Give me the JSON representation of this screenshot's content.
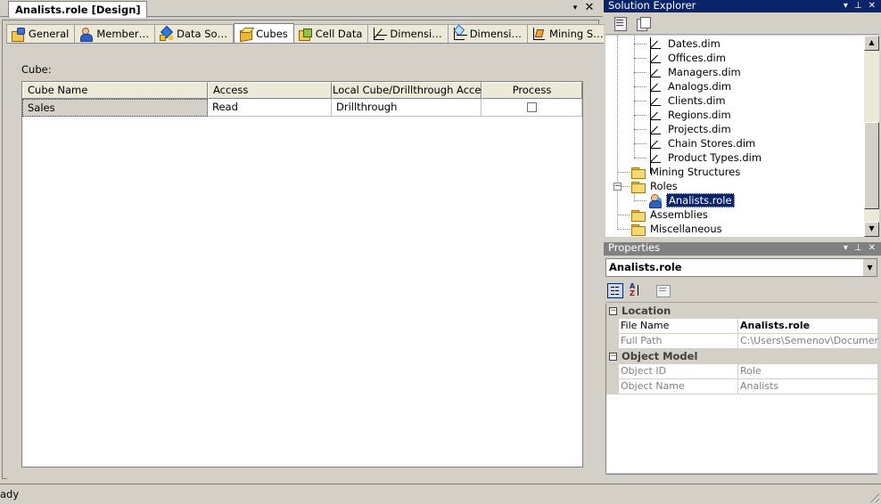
{
  "document": {
    "tab_title": "Analists.role [Design]",
    "dropdown_glyph": "▾",
    "close_glyph": "✕"
  },
  "designer_tabs": [
    {
      "label": "General",
      "icon": "general-icon"
    },
    {
      "label": "Member…",
      "icon": "membership-icon"
    },
    {
      "label": "Data So…",
      "icon": "data-sources-icon"
    },
    {
      "label": "Cubes",
      "icon": "cube-icon",
      "active": true
    },
    {
      "label": "Cell Data",
      "icon": "cell-data-icon"
    },
    {
      "label": "Dimensi…",
      "icon": "dimensions-icon"
    },
    {
      "label": "Dimensi…",
      "icon": "dimension-data-icon"
    },
    {
      "label": "Mining S…",
      "icon": "mining-structures-icon"
    }
  ],
  "cubes": {
    "label": "Cube:",
    "columns": [
      "Cube Name",
      "Access",
      "Local Cube/Drillthrough Access",
      "Process"
    ],
    "rows": [
      {
        "name": "Sales",
        "access": "Read",
        "local": "Drillthrough",
        "process": false
      }
    ]
  },
  "status": {
    "text": "ady"
  },
  "solution_explorer": {
    "title": "Solution Explorer",
    "dims": [
      "Dates.dim",
      "Offices.dim",
      "Managers.dim",
      "Analogs.dim",
      "Clients.dim",
      "Regions.dim",
      "Projects.dim",
      "Chain Stores.dim",
      "Product Types.dim"
    ],
    "folders": {
      "mining": "Mining Structures",
      "roles": "Roles",
      "assemblies": "Assemblies",
      "misc": "Miscellaneous"
    },
    "selected_role": "Analists.role"
  },
  "properties": {
    "title": "Properties",
    "object": "Analists.role",
    "categories": [
      {
        "name": "Location",
        "rows": [
          {
            "name": "File Name",
            "value": "Analists.role",
            "bold": true
          },
          {
            "name": "Full Path",
            "value": "C:\\Users\\Semenov\\Documents\\V",
            "readonly": true
          }
        ]
      },
      {
        "name": "Object Model",
        "rows": [
          {
            "name": "Object ID",
            "value": "Role",
            "readonly": true
          },
          {
            "name": "Object Name",
            "value": "Analists",
            "readonly": true
          }
        ]
      }
    ]
  },
  "panel_buttons": {
    "dropdown": "▾",
    "pin": "⊥",
    "close": "✕"
  },
  "glyphs": {
    "expander_minus": "−",
    "scroll_up": "▲",
    "scroll_down": "▼",
    "combo_arrow": "▼"
  }
}
